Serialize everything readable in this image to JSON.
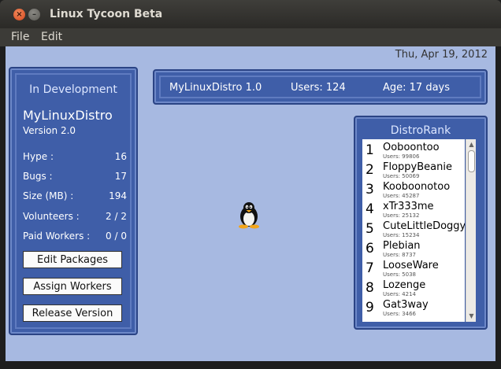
{
  "window": {
    "title": "Linux Tycoon Beta"
  },
  "menubar": {
    "file": "File",
    "edit": "Edit"
  },
  "date": "Thu, Apr 19, 2012",
  "dev_panel": {
    "heading": "In Development",
    "distro_name": "MyLinuxDistro",
    "version": "Version 2.0",
    "stats": [
      {
        "label": "Hype :",
        "value": "16"
      },
      {
        "label": "Bugs :",
        "value": "17"
      },
      {
        "label": "Size (MB) :",
        "value": "194"
      },
      {
        "label": "Volunteers :",
        "value": "2 / 2"
      },
      {
        "label": "Paid Workers :",
        "value": "0 / 0"
      }
    ],
    "buttons": {
      "edit_packages": "Edit Packages",
      "assign_workers": "Assign Workers",
      "release_version": "Release Version"
    }
  },
  "info_bar": {
    "distro": "MyLinuxDistro 1.0",
    "users": "Users: 124",
    "age": "Age: 17 days"
  },
  "distrorank": {
    "heading": "DistroRank",
    "items": [
      {
        "rank": "1",
        "name": "Ooboontoo",
        "users": "Users: 99806"
      },
      {
        "rank": "2",
        "name": "FloppyBeanie",
        "users": "Users: 50069"
      },
      {
        "rank": "3",
        "name": "Kooboonotoo",
        "users": "Users: 45287"
      },
      {
        "rank": "4",
        "name": "xTr333me",
        "users": "Users: 25132"
      },
      {
        "rank": "5",
        "name": "CuteLittleDoggy",
        "users": "Users: 15234"
      },
      {
        "rank": "6",
        "name": "Plebian",
        "users": "Users: 8737"
      },
      {
        "rank": "7",
        "name": "LooseWare",
        "users": "Users: 5038"
      },
      {
        "rank": "8",
        "name": "Lozenge",
        "users": "Users: 4214"
      },
      {
        "rank": "9",
        "name": "Gat3way",
        "users": "Users: 3466"
      }
    ]
  },
  "icons": {
    "close": "close-icon",
    "minimize": "minimize-icon",
    "mascot": "tux-penguin-icon"
  },
  "colors": {
    "background": "#a7b9e1",
    "panel": "#3f5ea8",
    "panel_border": "#2b4485"
  }
}
